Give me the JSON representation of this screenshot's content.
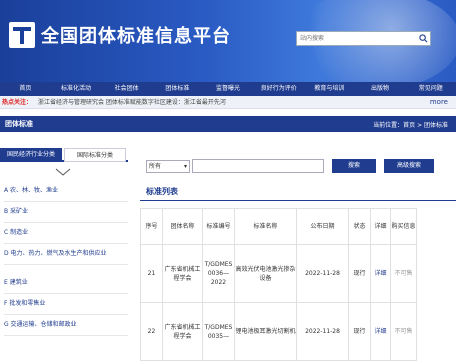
{
  "header": {
    "site_title": "全国团体标准信息平台",
    "search_placeholder": "站内搜索"
  },
  "nav": [
    "首页",
    "标准化活动",
    "社会团体",
    "团体标准",
    "监督曝光",
    "良好行为评价",
    "教育与培训",
    "出版物",
    "常见问题"
  ],
  "hot": {
    "label": "热点关注：",
    "text": "浙江省经济与管理研究会 团体标准赋能数字社区建设：浙江省最开先河",
    "more": "more"
  },
  "section": {
    "title": "团体标准",
    "breadcrumb": "当前位置：首页 > 团体标准"
  },
  "tabs": {
    "national": "国民经济行业分类",
    "standard": "国际标准分类"
  },
  "categories": [
    "A 农、林、牧、渔业",
    "B 采矿业",
    "C 制造业",
    "D 电力、热力、燃气及水生产和供应业",
    "E 建筑业",
    "F 批发和零售业",
    "G 交通运输、仓储和邮政业"
  ],
  "filter": {
    "select": "所有",
    "search_btn": "搜索",
    "adv_btn": "高级搜索"
  },
  "list": {
    "title": "标准列表",
    "headers": [
      "序号",
      "团体名称",
      "标准编号",
      "标准名称",
      "公布日期",
      "状态",
      "详细",
      "购买信息"
    ],
    "rows": [
      {
        "no": "21",
        "org": "广东省机械工程学会",
        "code": "T/GDMES 0036—2022",
        "name": "高效光伏电池激光掺杂设备",
        "date": "2022-11-28",
        "status": "现行",
        "detail": "详细",
        "buy": "不可售"
      },
      {
        "no": "22",
        "org": "广东省机械工程学会",
        "code": "T/GDMES 0035—",
        "name": "锂电池极耳激光切割机",
        "date": "2022-11-28",
        "status": "现行",
        "detail": "详细",
        "buy": "不可售"
      }
    ]
  }
}
